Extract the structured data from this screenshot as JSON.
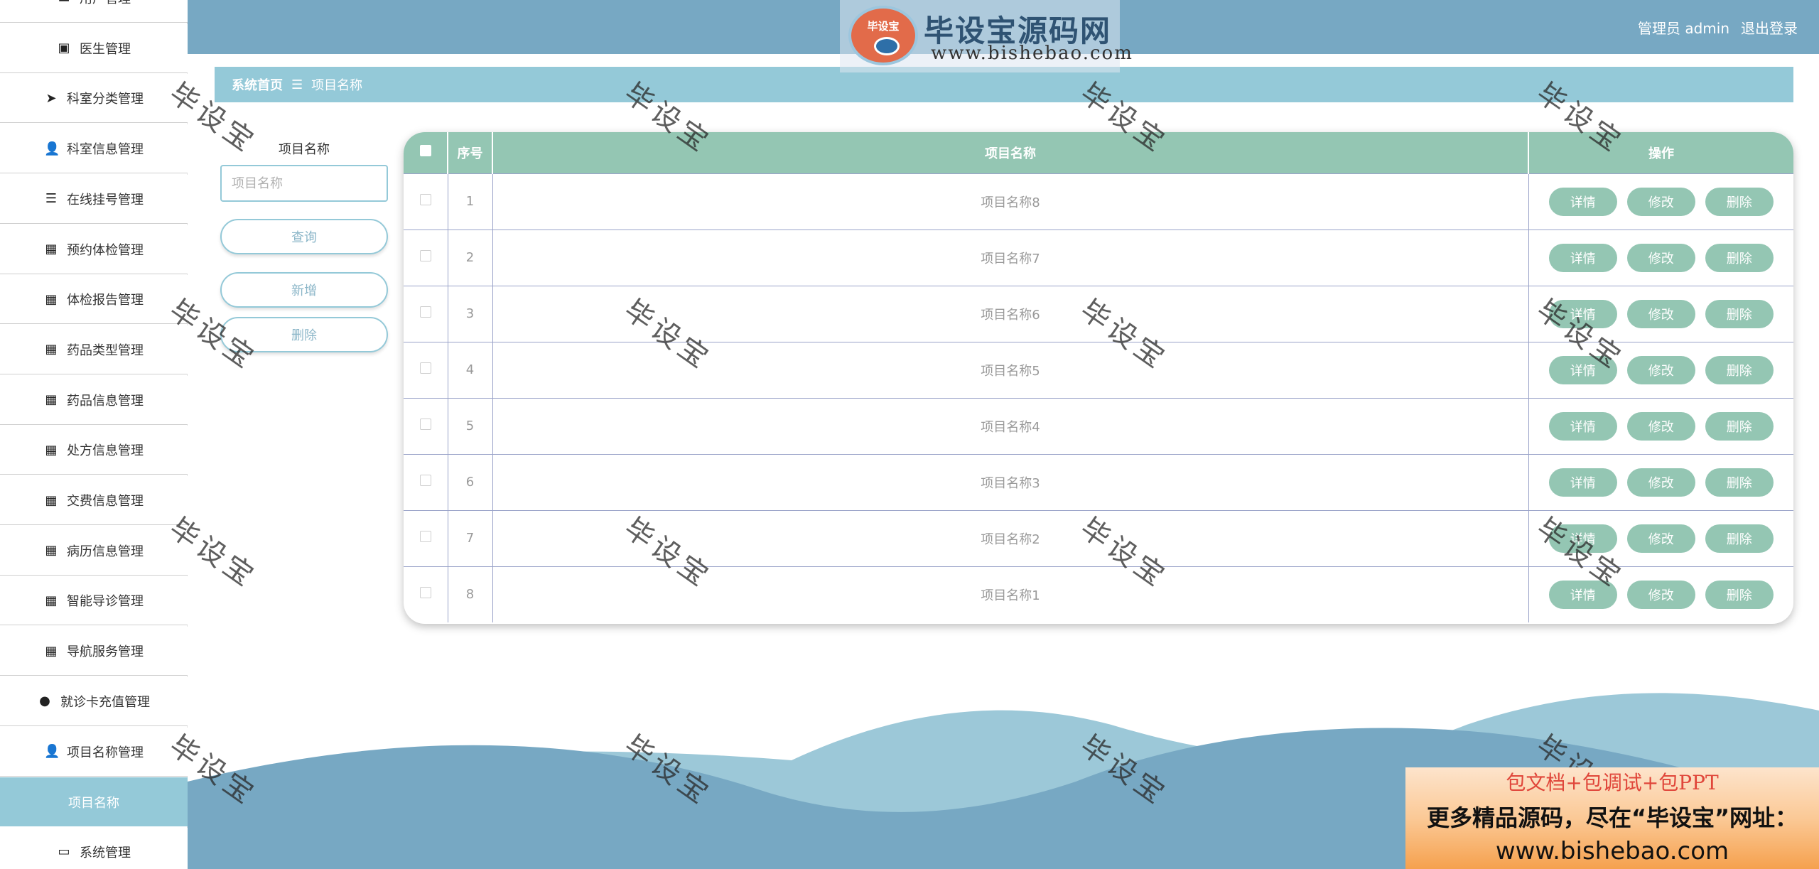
{
  "header": {
    "user_label": "管理员 admin",
    "logout_label": "退出登录"
  },
  "logo": {
    "badge": "毕设宝",
    "title": "毕设宝源码网",
    "url": "www.bishebao.com"
  },
  "sidebar": {
    "items": [
      {
        "label": "用户管理",
        "icon": "id-card-icon"
      },
      {
        "label": "医生管理",
        "icon": "clipboard-icon"
      },
      {
        "label": "科室分类管理",
        "icon": "paper-plane-icon"
      },
      {
        "label": "科室信息管理",
        "icon": "user-icon"
      },
      {
        "label": "在线挂号管理",
        "icon": "sliders-icon"
      },
      {
        "label": "预约体检管理",
        "icon": "grid-icon"
      },
      {
        "label": "体检报告管理",
        "icon": "grid-icon"
      },
      {
        "label": "药品类型管理",
        "icon": "grid-icon"
      },
      {
        "label": "药品信息管理",
        "icon": "grid-icon"
      },
      {
        "label": "处方信息管理",
        "icon": "grid-icon"
      },
      {
        "label": "交费信息管理",
        "icon": "grid-icon"
      },
      {
        "label": "病历信息管理",
        "icon": "grid-icon"
      },
      {
        "label": "智能导诊管理",
        "icon": "grid-icon"
      },
      {
        "label": "导航服务管理",
        "icon": "grid-icon"
      },
      {
        "label": "就诊卡充值管理",
        "icon": "map-marker-icon"
      },
      {
        "label": "项目名称管理",
        "icon": "user-icon"
      },
      {
        "label": "项目名称",
        "icon": ""
      },
      {
        "label": "系统管理",
        "icon": "laptop-icon"
      }
    ]
  },
  "breadcrumb": {
    "home": "系统首页",
    "separator": "☰",
    "current": "项目名称"
  },
  "search": {
    "label": "项目名称",
    "placeholder": "项目名称",
    "query_label": "查询",
    "add_label": "新增",
    "delete_label": "删除"
  },
  "table": {
    "headers": {
      "index": "序号",
      "name": "项目名称",
      "ops": "操作"
    },
    "ops": {
      "detail": "详情",
      "edit": "修改",
      "delete": "删除"
    },
    "rows": [
      {
        "index": "1",
        "name": "项目名称8"
      },
      {
        "index": "2",
        "name": "项目名称7"
      },
      {
        "index": "3",
        "name": "项目名称6"
      },
      {
        "index": "4",
        "name": "项目名称5"
      },
      {
        "index": "5",
        "name": "项目名称4"
      },
      {
        "index": "6",
        "name": "项目名称3"
      },
      {
        "index": "7",
        "name": "项目名称2"
      },
      {
        "index": "8",
        "name": "项目名称1"
      }
    ]
  },
  "watermark": "毕设宝",
  "promo": {
    "line1": "包文档+包调试+包PPT",
    "line2": "更多精品源码，尽在“毕设宝”网址：",
    "line3": "www.bishebao.com"
  },
  "colors": {
    "header": "#77a8c3",
    "accent": "#94c9d8",
    "table_header": "#94c6b3"
  }
}
